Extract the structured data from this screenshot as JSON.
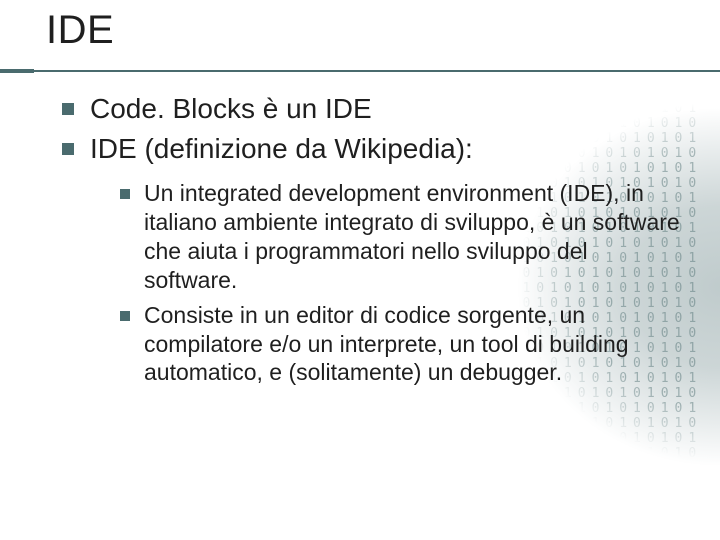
{
  "title": "IDE",
  "bullets": {
    "level1": [
      {
        "text": "Code. Blocks è un IDE"
      },
      {
        "text": "IDE (definizione da Wikipedia):"
      }
    ],
    "level2": [
      {
        "text": "Un integrated development environment (IDE), in italiano ambiente integrato di sviluppo, è un software che aiuta i programmatori nello sviluppo del software."
      },
      {
        "text": "Consiste in un editor di codice sorgente, un compilatore e/o un interprete, un tool di building automatico, e (solitamente) un debugger."
      }
    ]
  }
}
